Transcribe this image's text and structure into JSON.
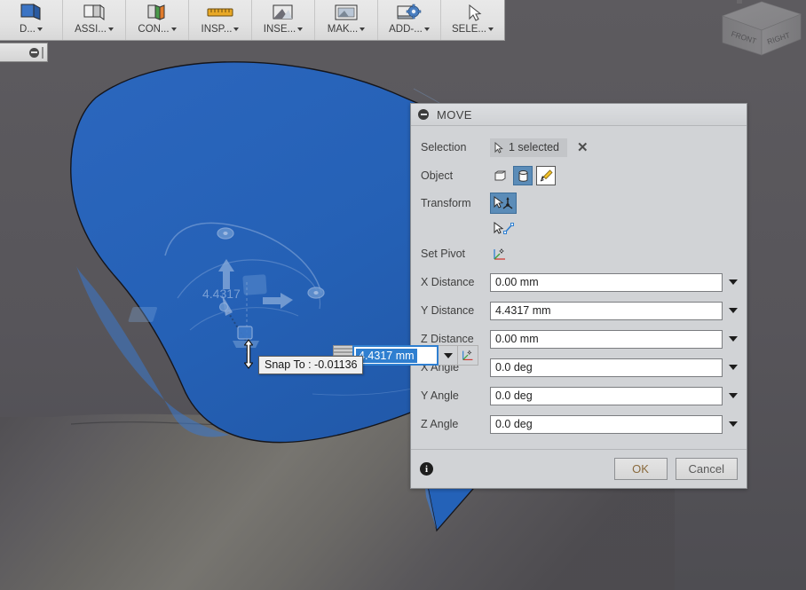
{
  "app": {
    "background_color": "#58565a",
    "model_color": "#2563b8"
  },
  "toolbar": {
    "items": [
      {
        "label": "D...",
        "icon": "modify-icon",
        "has_caret": true
      },
      {
        "label": "ASSI...",
        "icon": "assemble-icon",
        "has_caret": true
      },
      {
        "label": "CON...",
        "icon": "construct-icon",
        "has_caret": true
      },
      {
        "label": "INSP...",
        "icon": "inspect-ruler-icon",
        "has_caret": true
      },
      {
        "label": "INSE...",
        "icon": "insert-icon",
        "has_caret": true
      },
      {
        "label": "MAK...",
        "icon": "make-print-icon",
        "has_caret": true
      },
      {
        "label": "ADD-...",
        "icon": "add-ins-gear-icon",
        "has_caret": true
      },
      {
        "label": "SELE...",
        "icon": "select-arrow-icon",
        "has_caret": true
      }
    ]
  },
  "mini_panel": {
    "collapse_icon": "collapse-icon",
    "grip_icon": "drag-grip-icon"
  },
  "viewcube": {
    "front_label": "FRONT",
    "right_label": "RIGHT"
  },
  "manipulator": {
    "dimension_label": "4.4317",
    "axis_arrow_icons": [
      "up-arrow-handle",
      "right-arrow-handle"
    ],
    "rotation_handles": [
      "rotate-handle-top",
      "rotate-handle-right"
    ]
  },
  "dialog": {
    "title": "MOVE",
    "collapse_icon": "collapse-icon",
    "selection": {
      "label": "Selection",
      "chip_text": "1 selected",
      "chip_icon": "select-cursor-icon",
      "clear_icon": "close-x-icon"
    },
    "object": {
      "label": "Object",
      "options": [
        {
          "name": "bodies-icon",
          "active": false
        },
        {
          "name": "components-icon",
          "active": true
        },
        {
          "name": "sketch-objects-icon",
          "active": false
        }
      ]
    },
    "transform": {
      "label": "Transform",
      "options": [
        {
          "name": "move-free-icon",
          "active": true
        },
        {
          "name": "point-to-point-icon",
          "active": false
        }
      ]
    },
    "set_pivot": {
      "label": "Set Pivot",
      "icon": "set-pivot-axis-icon"
    },
    "fields": [
      {
        "label": "X Distance",
        "value": "0.00 mm"
      },
      {
        "label": "Y Distance",
        "value": "4.4317 mm"
      },
      {
        "label": "Z Distance",
        "value": "0.00 mm"
      },
      {
        "label": "X Angle",
        "value": "0.0 deg"
      },
      {
        "label": "Y Angle",
        "value": "0.0 deg"
      },
      {
        "label": "Z Angle",
        "value": "0.0 deg"
      }
    ],
    "footer": {
      "info_icon": "info-icon",
      "ok_label": "OK",
      "cancel_label": "Cancel"
    }
  },
  "float_input": {
    "value": "4.4317 mm",
    "grip_icon": "drag-grip-icon",
    "caret_icon": "chevron-down-icon",
    "pivot_icon": "set-pivot-axis-icon"
  },
  "snap_tooltip": {
    "text": "Snap To : -0.01136"
  },
  "cursor": {
    "icon": "move-vertical-cursor"
  }
}
